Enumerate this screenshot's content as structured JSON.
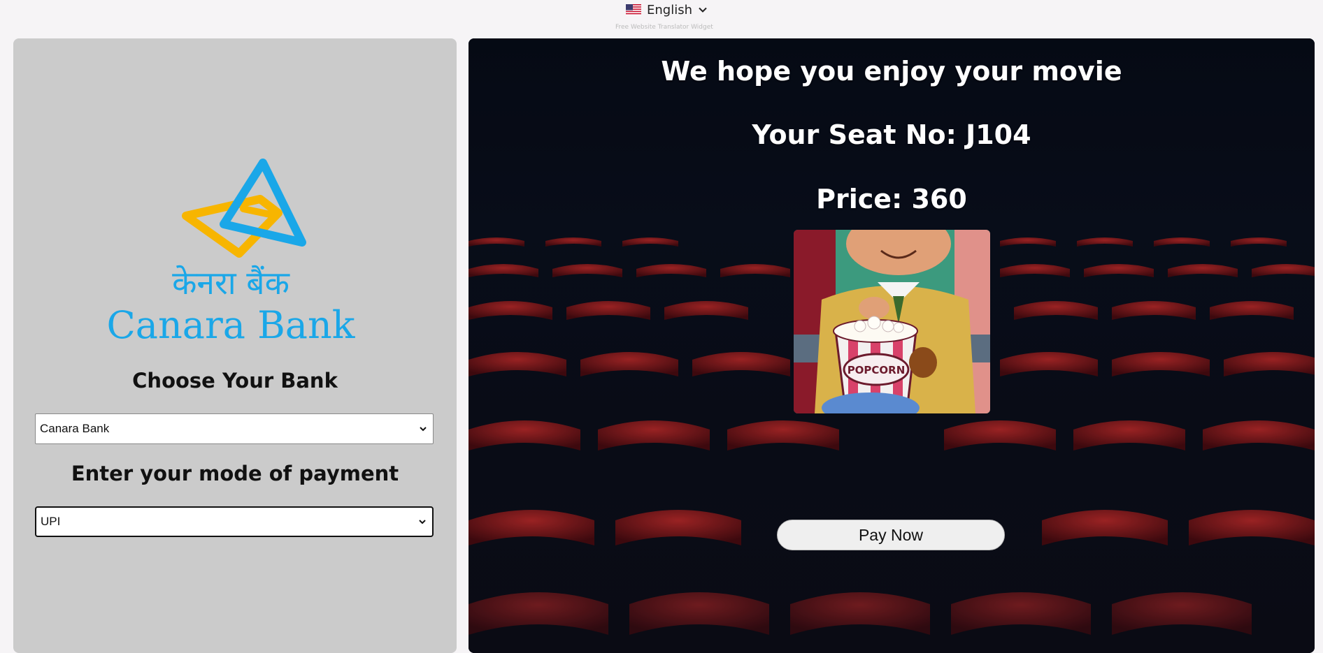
{
  "language_widget": {
    "flag_icon": "us-flag-icon",
    "label": "English",
    "note": "Free Website Translator Widget"
  },
  "bank_panel": {
    "logo": {
      "hindi": "केनरा बैंक",
      "english": "Canara Bank",
      "colors": {
        "blue": "#1aa7e8",
        "gold": "#f7b500"
      }
    },
    "choose_bank_heading": "Choose Your Bank",
    "bank_select": {
      "value": "Canara Bank"
    },
    "payment_heading": "Enter your mode of payment",
    "payment_select": {
      "value": "UPI"
    }
  },
  "booking_panel": {
    "message": "We hope you enjoy your movie",
    "seat": "Your Seat No: J104",
    "price": "Price: 360",
    "popcorn_label": "POPCORN",
    "pay_button": "Pay Now"
  }
}
